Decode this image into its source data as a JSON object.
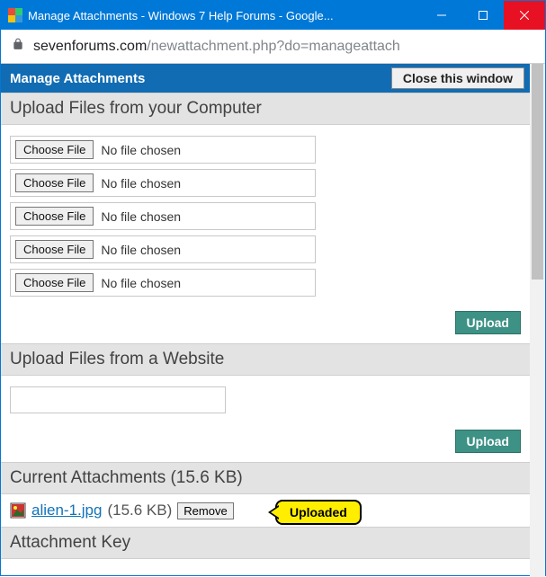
{
  "window": {
    "title": "Manage Attachments - Windows 7 Help Forums - Google..."
  },
  "address": {
    "host": "sevenforums.com",
    "path": "/newattachment.php?do=manageattach"
  },
  "header": {
    "title": "Manage Attachments",
    "close_label": "Close this window"
  },
  "section_computer": {
    "title": "Upload Files from your Computer",
    "rows": [
      {
        "choose": "Choose File",
        "status": "No file chosen"
      },
      {
        "choose": "Choose File",
        "status": "No file chosen"
      },
      {
        "choose": "Choose File",
        "status": "No file chosen"
      },
      {
        "choose": "Choose File",
        "status": "No file chosen"
      },
      {
        "choose": "Choose File",
        "status": "No file chosen"
      }
    ],
    "upload_label": "Upload"
  },
  "section_website": {
    "title": "Upload Files from a Website",
    "url_value": "",
    "upload_label": "Upload"
  },
  "section_current": {
    "title": "Current Attachments (15.6 KB)",
    "item": {
      "name": "alien-1.jpg",
      "size": "(15.6 KB)",
      "remove": "Remove"
    },
    "callout": "Uploaded"
  },
  "section_key": {
    "title": "Attachment Key"
  }
}
